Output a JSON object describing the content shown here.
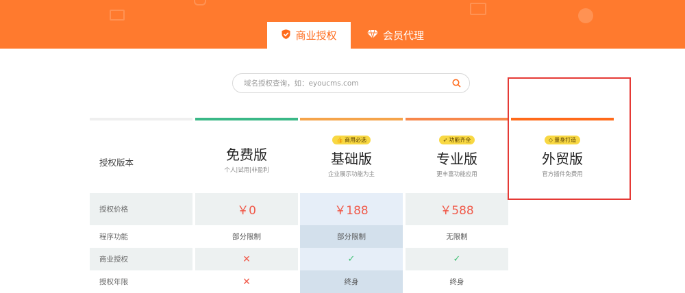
{
  "colors": {
    "banner": "#ff7a2e",
    "accent": "#ff6a1a",
    "free_line": "#3ab887",
    "basic_line": "#f5a44a",
    "pro_line": "#f7874a",
    "trade_line": "#ff6a1a",
    "price": "#f05a4a",
    "check": "#3fc173",
    "highlight": "#e53935"
  },
  "tabs": [
    {
      "label": "商业授权",
      "icon": "shield-check-icon",
      "active": true
    },
    {
      "label": "会员代理",
      "icon": "diamond-icon",
      "active": false
    }
  ],
  "search": {
    "placeholder": "域名授权查询，如：eyoucms.com",
    "value": ""
  },
  "table": {
    "header_label": "授权版本",
    "plans": [
      {
        "name": "免费版",
        "desc": "个人|试用|非盈利",
        "badge": ""
      },
      {
        "name": "基础版",
        "desc": "企业展示功能为主",
        "badge": "商用必选",
        "badge_icon": "thumbs-up-icon"
      },
      {
        "name": "专业版",
        "desc": "更丰富功能应用",
        "badge": "功能齐全",
        "badge_icon": "rocket-icon"
      },
      {
        "name": "外贸版",
        "desc": "官方插件免费用",
        "badge": "量身打造",
        "badge_icon": "diamond-icon"
      }
    ],
    "rows": [
      {
        "label": "授权价格",
        "values": [
          "￥0",
          "￥188",
          "￥588"
        ]
      },
      {
        "label": "程序功能",
        "values": [
          "部分限制",
          "部分限制",
          "无限制"
        ]
      },
      {
        "label": "商业授权",
        "values": [
          "✕",
          "✓",
          "✓"
        ]
      },
      {
        "label": "授权年限",
        "values": [
          "✕",
          "终身",
          "终身"
        ]
      }
    ]
  }
}
